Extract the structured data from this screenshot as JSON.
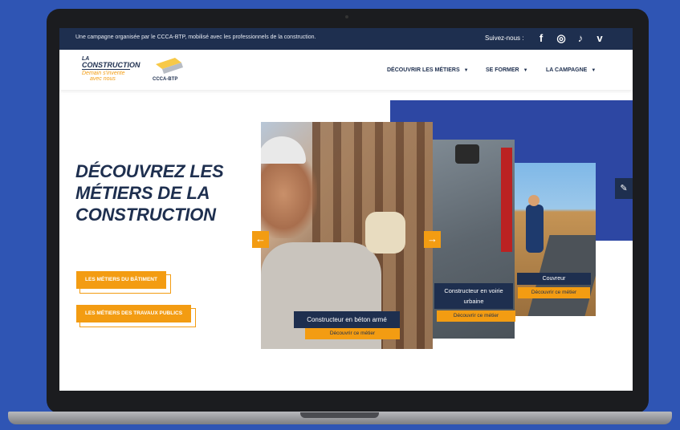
{
  "topbar": {
    "text": "Une campagne organisée par le CCCA-BTP, mobilisé avec les professionnels de la construction.",
    "follow_label": "Suivez-nous :",
    "social": [
      {
        "name": "facebook-icon",
        "glyph": "f"
      },
      {
        "name": "instagram-icon",
        "glyph": "◎"
      },
      {
        "name": "tiktok-icon",
        "glyph": "♪"
      },
      {
        "name": "vimeo-icon",
        "glyph": "v"
      }
    ]
  },
  "header": {
    "logo1": {
      "top": "LA",
      "main": "CONSTRUCTION",
      "sub": "Demain s'invente",
      "sub2": "avec nous"
    },
    "logo2": {
      "text": "CCCA-BTP"
    },
    "nav": [
      {
        "label": "DÉCOUVRIR LES MÉTIERS"
      },
      {
        "label": "SE FORMER"
      },
      {
        "label": "LA CAMPAGNE"
      }
    ],
    "caret": "▼"
  },
  "hero": {
    "title": "DÉCOUVREZ LES MÉTIERS DE LA CONSTRUCTION",
    "buttons": [
      {
        "label": "LES MÉTIERS DU BÂTIMENT"
      },
      {
        "label": "LES MÉTIERS DES TRAVAUX PUBLICS"
      }
    ]
  },
  "carousel": {
    "prev": "←",
    "next": "→",
    "cards": [
      {
        "title": "Constructeur en béton armé",
        "cta": "Découvrir ce métier"
      },
      {
        "title": "Constructeur en voirie urbaine",
        "cta": "Découvrir ce métier"
      },
      {
        "title": "Couvreur",
        "cta": "Découvrir ce métier"
      }
    ]
  },
  "side_tab": {
    "glyph": "✎"
  },
  "colors": {
    "navy": "#1e2f4f",
    "orange": "#f39c12",
    "blue": "#2d47a3",
    "background": "#2f55b4"
  }
}
